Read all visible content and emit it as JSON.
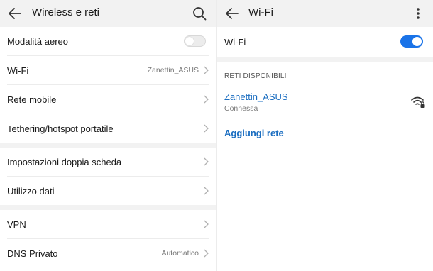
{
  "left": {
    "title": "Wireless e reti",
    "airplane": {
      "label": "Modalità aereo",
      "enabled": false
    },
    "items": [
      {
        "label": "Wi-Fi",
        "value": "Zanettin_ASUS"
      },
      {
        "label": "Rete mobile",
        "value": ""
      },
      {
        "label": "Tethering/hotspot portatile",
        "value": ""
      }
    ],
    "items2": [
      {
        "label": "Impostazioni doppia scheda",
        "value": ""
      },
      {
        "label": "Utilizzo dati",
        "value": ""
      }
    ],
    "items3": [
      {
        "label": "VPN",
        "value": ""
      },
      {
        "label": "DNS Privato",
        "value": "Automatico"
      }
    ]
  },
  "right": {
    "title": "Wi-Fi",
    "wifi": {
      "label": "Wi-Fi",
      "enabled": true
    },
    "section_title": "RETI DISPONIBILI",
    "network": {
      "ssid": "Zanettin_ASUS",
      "status": "Connessa"
    },
    "add_label": "Aggiungi rete"
  },
  "colors": {
    "accent": "#1a73e8",
    "link": "#1a6dc0",
    "background_band": "#f2f2f2"
  }
}
